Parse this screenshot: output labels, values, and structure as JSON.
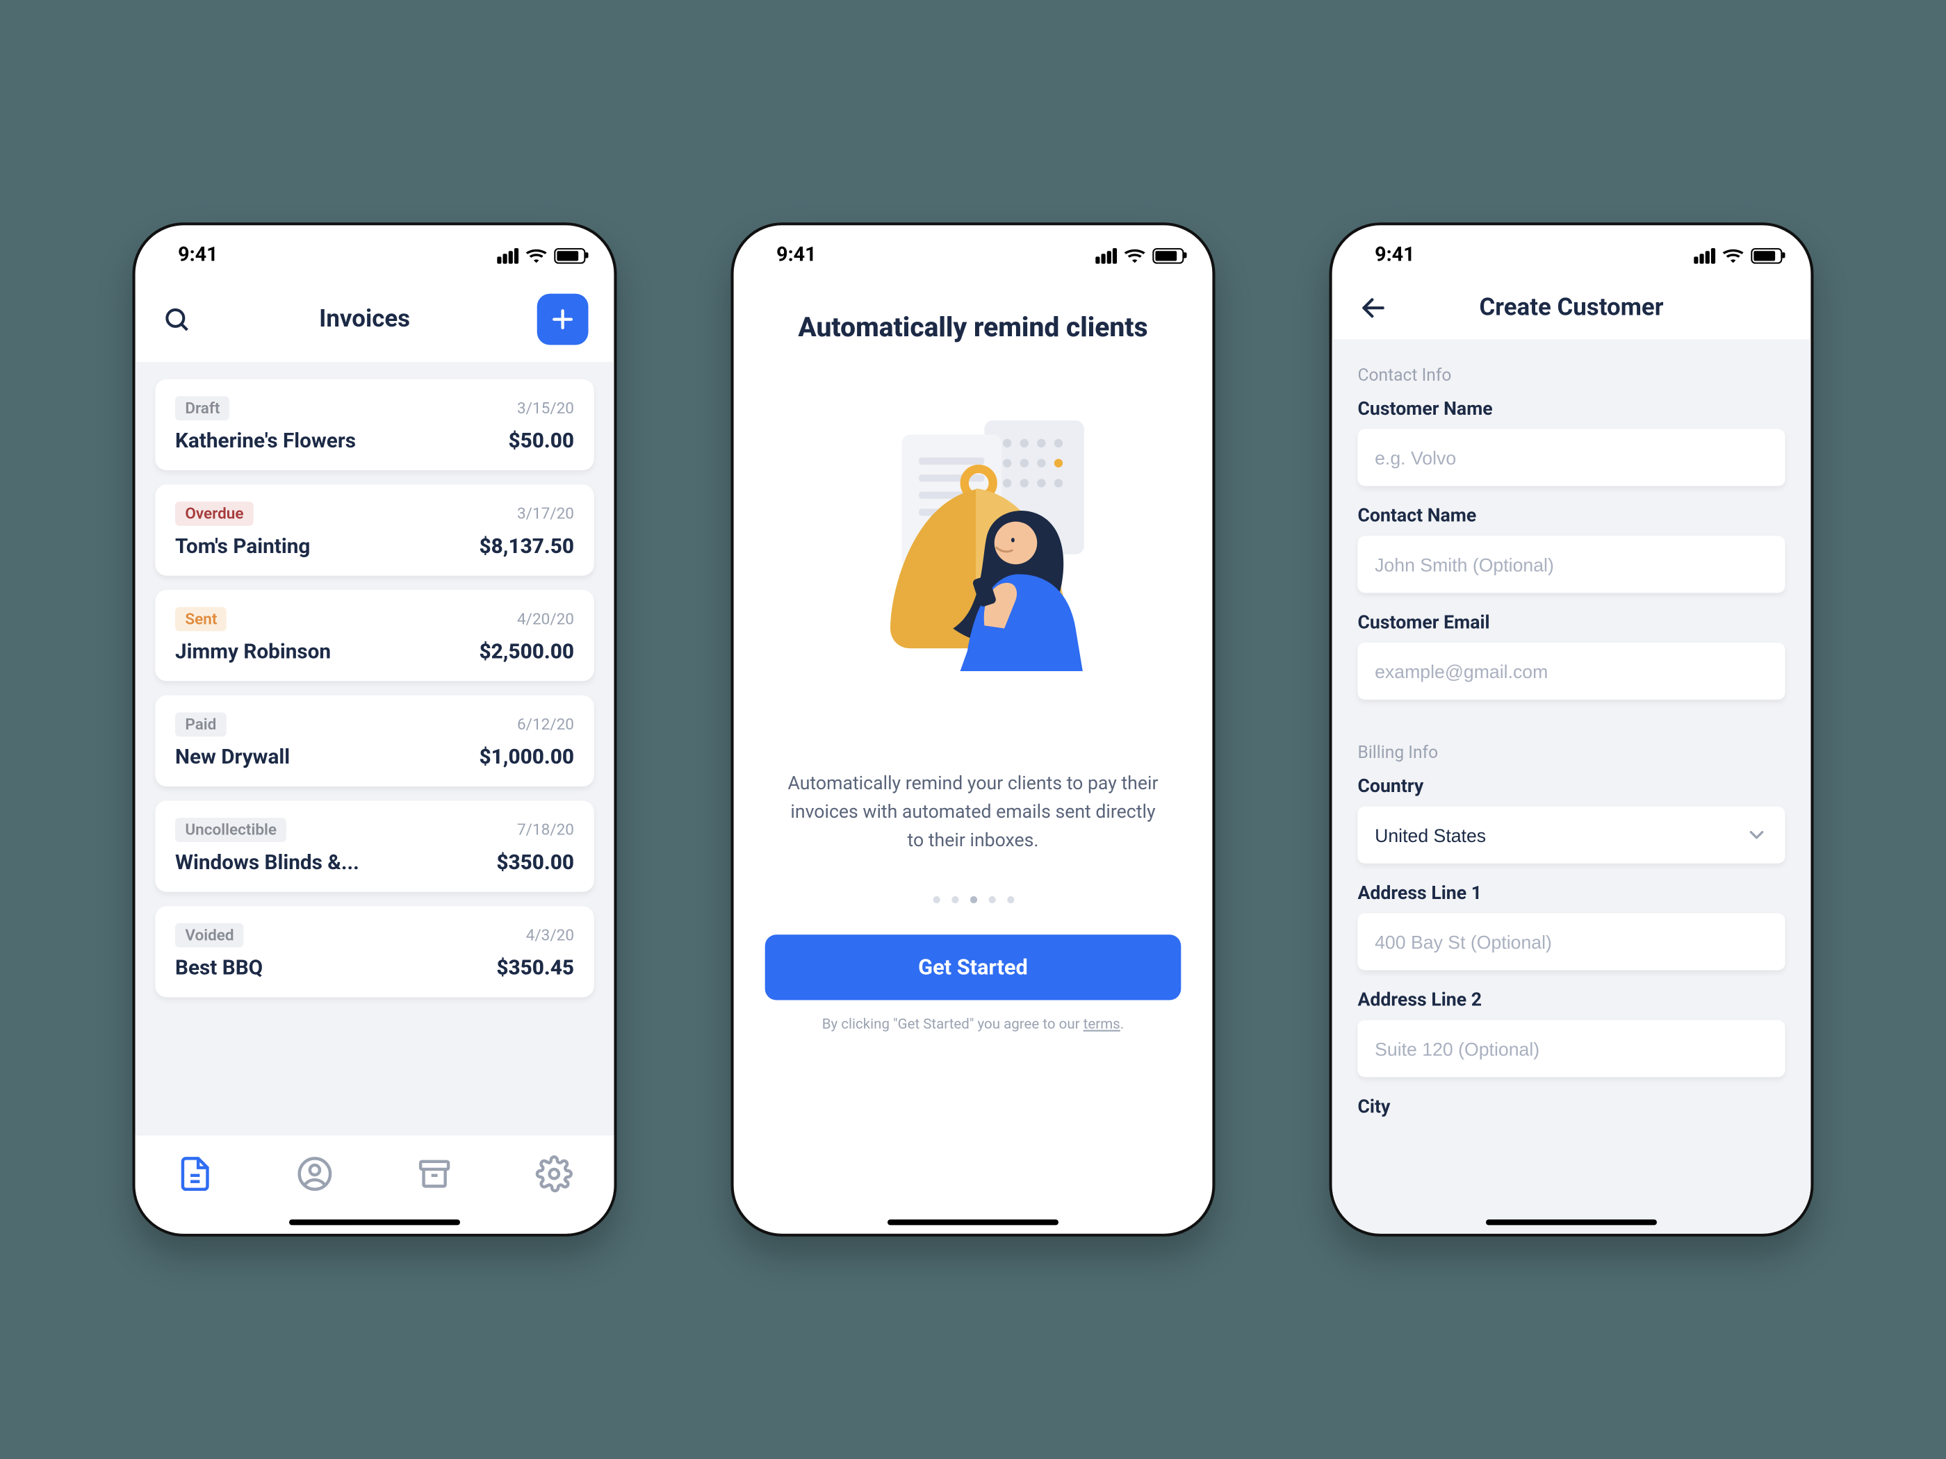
{
  "status_bar": {
    "time": "9:41"
  },
  "colors": {
    "primary": "#2f6df2",
    "ink": "#1c2a46",
    "muted": "#9aa2b1"
  },
  "invoices_screen": {
    "title": "Invoices",
    "invoices": [
      {
        "status_label": "Draft",
        "date": "3/15/20",
        "vendor": "Katherine's Flowers",
        "amount": "$50.00",
        "pill_fg": "#878b93",
        "pill_bg": "#eef0f3"
      },
      {
        "status_label": "Overdue",
        "date": "3/17/20",
        "vendor": "Tom's Painting",
        "amount": "$8,137.50",
        "pill_fg": "#a63a3a",
        "pill_bg": "#f7e7e7"
      },
      {
        "status_label": "Sent",
        "date": "4/20/20",
        "vendor": "Jimmy Robinson",
        "amount": "$2,500.00",
        "pill_fg": "#e08a3c",
        "pill_bg": "#fbeede"
      },
      {
        "status_label": "Paid",
        "date": "6/12/20",
        "vendor": "New Drywall",
        "amount": "$1,000.00",
        "pill_fg": "#878b93",
        "pill_bg": "#eef0f3"
      },
      {
        "status_label": "Uncollectible",
        "date": "7/18/20",
        "vendor": "Windows Blinds &...",
        "amount": "$350.00",
        "pill_fg": "#878b93",
        "pill_bg": "#eef0f3"
      },
      {
        "status_label": "Voided",
        "date": "4/3/20",
        "vendor": "Best BBQ",
        "amount": "$350.45",
        "pill_fg": "#878b93",
        "pill_bg": "#eef0f3"
      }
    ],
    "tabs": [
      {
        "icon": "document-icon",
        "active": true
      },
      {
        "icon": "user-icon",
        "active": false
      },
      {
        "icon": "archive-icon",
        "active": false
      },
      {
        "icon": "gear-icon",
        "active": false
      }
    ]
  },
  "onboarding_screen": {
    "title": "Automatically remind clients",
    "body": "Automatically remind your clients to pay their invoices with automated emails sent directly to their inboxes.",
    "page_count": 5,
    "active_page_index": 2,
    "cta_label": "Get Started",
    "tos_prefix": "By clicking \"Get Started\" you agree to our ",
    "tos_link": "terms",
    "tos_suffix": "."
  },
  "create_customer_screen": {
    "title": "Create Customer",
    "sections": {
      "contact_info_label": "Contact Info",
      "billing_info_label": "Billing Info"
    },
    "fields": {
      "customer_name": {
        "label": "Customer Name",
        "placeholder": "e.g. Volvo"
      },
      "contact_name": {
        "label": "Contact Name",
        "placeholder": "John Smith (Optional)"
      },
      "customer_email": {
        "label": "Customer Email",
        "placeholder": "example@gmail.com"
      },
      "country": {
        "label": "Country",
        "value": "United States"
      },
      "address1": {
        "label": "Address Line 1",
        "placeholder": "400 Bay St (Optional)"
      },
      "address2": {
        "label": "Address Line 2",
        "placeholder": "Suite 120 (Optional)"
      },
      "city": {
        "label": "City"
      }
    }
  }
}
